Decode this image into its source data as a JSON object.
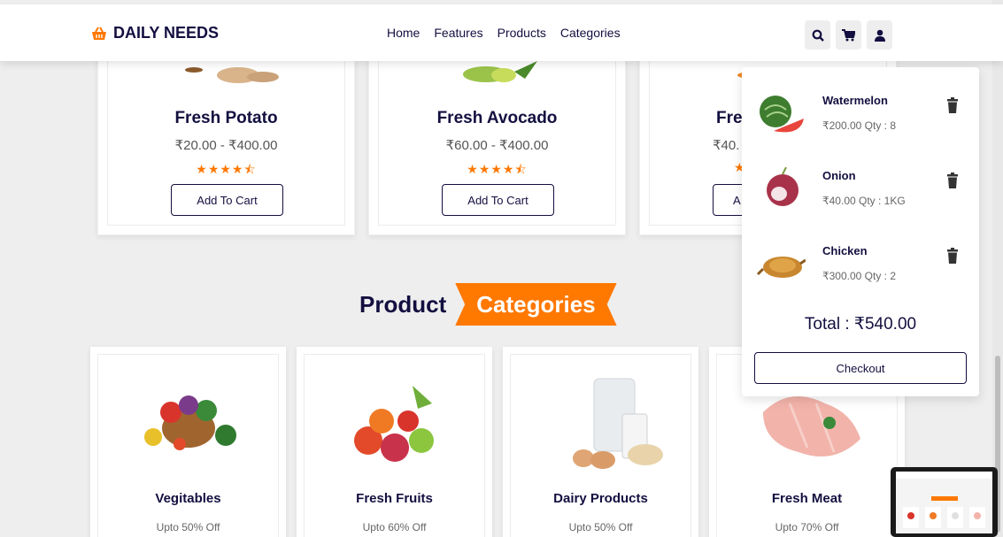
{
  "header": {
    "logo_text": "DAILY NEEDS",
    "nav": [
      "Home",
      "Features",
      "Products",
      "Categories"
    ],
    "icons": [
      "search-icon",
      "cart-icon",
      "user-icon"
    ]
  },
  "products": [
    {
      "name": "Fresh Potato",
      "price": "₹20.00 - ₹400.00",
      "rating": 4.5,
      "button": "Add To Cart"
    },
    {
      "name": "Fresh Avocado",
      "price": "₹60.00 - ₹400.00",
      "rating": 4.5,
      "button": "Add To Cart"
    },
    {
      "name": "Fre",
      "price": "₹40.",
      "rating": 4.5,
      "button": "A"
    }
  ],
  "section": {
    "title_1": "Product",
    "title_2": "Categories"
  },
  "categories": [
    {
      "name": "Vegitables",
      "offer": "Upto 50% Off"
    },
    {
      "name": "Fresh Fruits",
      "offer": "Upto 60% Off"
    },
    {
      "name": "Dairy Products",
      "offer": "Upto 50% Off"
    },
    {
      "name": "Fresh Meat",
      "offer": "Upto 70% Off"
    }
  ],
  "cart": {
    "items": [
      {
        "name": "Watermelon",
        "meta": "₹200.00   Qty : 8"
      },
      {
        "name": "Onion",
        "meta": "₹40.00   Qty : 1KG"
      },
      {
        "name": "Chicken",
        "meta": "₹300.00   Qty : 2"
      }
    ],
    "total": "Total : ₹540.00",
    "checkout": "Checkout"
  },
  "colors": {
    "accent": "#ff7800",
    "dark": "#130f40",
    "background": "#eeeeee"
  }
}
